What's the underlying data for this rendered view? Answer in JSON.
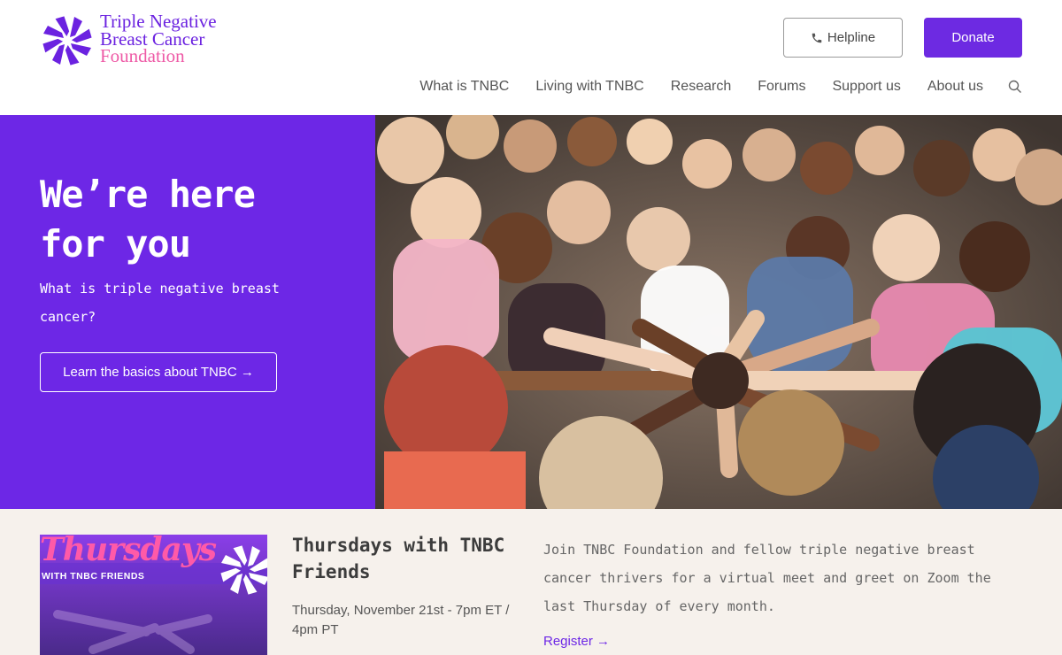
{
  "header": {
    "logo": {
      "line1": "Triple Negative",
      "line2": "Breast Cancer",
      "line3": "Foundation"
    },
    "helpline_label": "Helpline",
    "donate_label": "Donate",
    "nav": [
      {
        "label": "What is TNBC"
      },
      {
        "label": "Living with TNBC"
      },
      {
        "label": "Research"
      },
      {
        "label": "Forums"
      },
      {
        "label": "Support us"
      },
      {
        "label": "About us"
      }
    ],
    "search_icon": "search-icon",
    "helpline_icon": "phone-icon"
  },
  "hero": {
    "title_line1": "We’re here",
    "title_line2": "for you",
    "subtitle": "What is triple negative breast cancer?",
    "button_label": "Learn the basics about TNBC →"
  },
  "event": {
    "thumb_title": "Thursdays",
    "thumb_subtitle": "WITH TNBC FRIENDS",
    "title": "Thursdays with TNBC Friends",
    "date": "Thursday, November 21st - 7pm ET / 4pm PT",
    "description": "Join TNBC Foundation and fellow triple negative breast cancer thrivers for a virtual meet and greet on Zoom the last Thursday of every month.",
    "link_label": "Register →"
  },
  "colors": {
    "brand_purple": "#6d27e6",
    "brand_pink": "#ee5aa6",
    "band_bg": "#f6f1ec"
  }
}
